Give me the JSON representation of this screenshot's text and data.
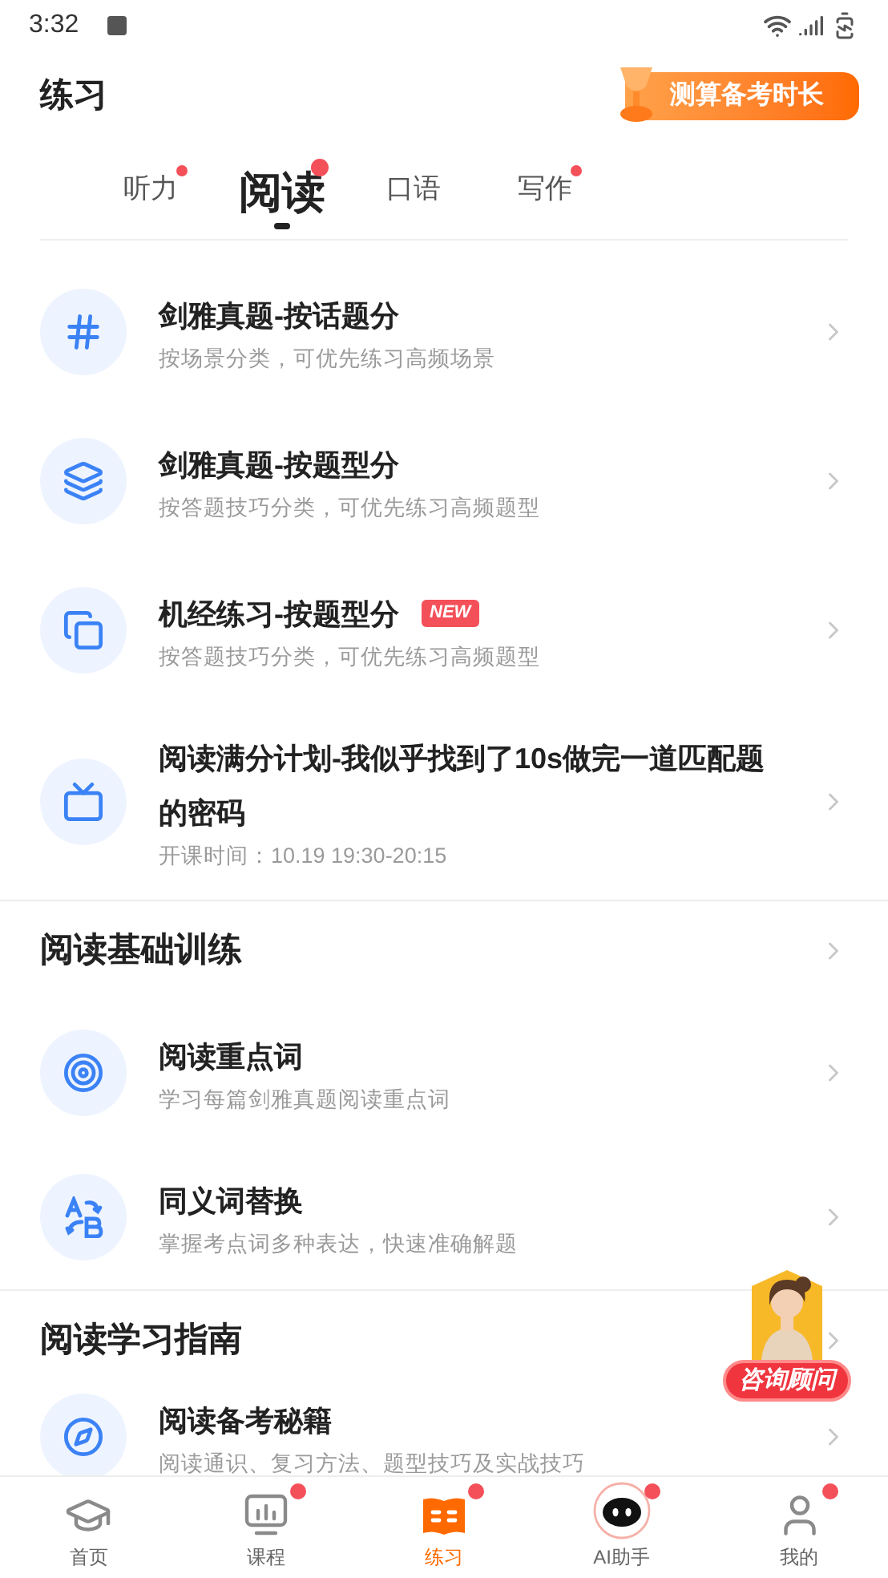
{
  "status_bar": {
    "time": "3:32"
  },
  "header": {
    "title": "练习",
    "promo": "测算备考时长"
  },
  "tabs": [
    {
      "label": "听力",
      "selected": false,
      "dot": true
    },
    {
      "label": "阅读",
      "selected": true,
      "dot": true
    },
    {
      "label": "口语",
      "selected": false,
      "dot": false
    },
    {
      "label": "写作",
      "selected": false,
      "dot": true
    }
  ],
  "sections": [
    {
      "items": [
        {
          "title": "剑雅真题-按话题分",
          "subtitle": "按场景分类，可优先练习高频场景"
        },
        {
          "title": "剑雅真题-按题型分",
          "subtitle": "按答题技巧分类，可优先练习高频题型"
        },
        {
          "title": "机经练习-按题型分",
          "badge": "NEW",
          "subtitle": "按答题技巧分类，可优先练习高频题型"
        },
        {
          "title": "阅读满分计划-我似乎找到了10s做完一道匹配题的密码",
          "subtitle": "开课时间：10.19 19:30-20:15"
        }
      ]
    },
    {
      "title": "阅读基础训练",
      "items": [
        {
          "title": "阅读重点词",
          "subtitle": "学习每篇剑雅真题阅读重点词"
        },
        {
          "title": "同义词替换",
          "subtitle": "掌握考点词多种表达，快速准确解题"
        }
      ]
    },
    {
      "title": "阅读学习指南",
      "items": [
        {
          "title": "阅读备考秘籍",
          "subtitle": "阅读通识、复习方法、题型技巧及实战技巧"
        }
      ]
    }
  ],
  "advisor": {
    "label": "咨询顾问"
  },
  "nav": [
    {
      "label": "首页",
      "selected": false,
      "dot": false
    },
    {
      "label": "课程",
      "selected": false,
      "dot": true
    },
    {
      "label": "练习",
      "selected": true,
      "dot": true
    },
    {
      "label": "AI助手",
      "selected": false,
      "dot": true
    },
    {
      "label": "我的",
      "selected": false,
      "dot": true
    }
  ]
}
